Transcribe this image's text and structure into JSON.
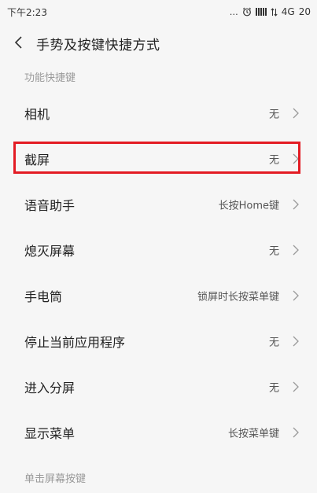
{
  "status_bar": {
    "time": "下午2:23",
    "dots": "…",
    "alarm_icon": "alarm-clock-icon",
    "network": "4G",
    "battery": "20"
  },
  "header": {
    "title": "手势及按键快捷方式",
    "back_icon": "chevron-left-icon"
  },
  "sections": [
    {
      "header": "功能快捷键"
    },
    {
      "header": "单击屏幕按键"
    }
  ],
  "items": [
    {
      "label": "相机",
      "value": "无"
    },
    {
      "label": "截屏",
      "value": "无"
    },
    {
      "label": "语音助手",
      "value": "长按Home键"
    },
    {
      "label": "熄灭屏幕",
      "value": "无"
    },
    {
      "label": "手电筒",
      "value": "锁屏时长按菜单键"
    },
    {
      "label": "停止当前应用程序",
      "value": "无"
    },
    {
      "label": "进入分屏",
      "value": "无"
    },
    {
      "label": "显示菜单",
      "value": "长按菜单键"
    }
  ],
  "colors": {
    "highlight": "#e31b23",
    "background": "#f6f6f6",
    "section_text": "#9a9a9a"
  }
}
